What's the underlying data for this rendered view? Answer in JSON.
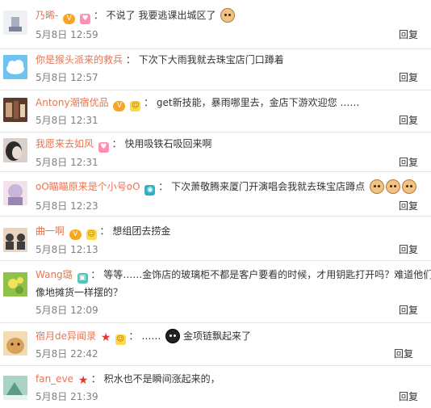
{
  "comments": [
    {
      "user": "乃晞-",
      "badges": [
        "vip",
        "heart"
      ],
      "text": "不说了 我要逃课出城区了",
      "emojis": [
        "emoji-doge"
      ],
      "date": "5月8日 12:59",
      "reply": "回复",
      "avatar_colors": [
        "#eef0f4",
        "#a7b0c2"
      ]
    },
    {
      "user": "你是猴头派来的救兵",
      "badges": [],
      "text": "下次下大雨我就去珠宝店门口蹲着",
      "emojis": [],
      "date": "5月8日 12:57",
      "reply": "回复",
      "avatar_colors": [
        "#6ec3f0",
        "#ffffff"
      ]
    },
    {
      "user": "Antony潮宿优品",
      "badges": [
        "vip",
        "face"
      ],
      "text": "get新技能，暴雨哪里去，金店下游欢迎您 ……",
      "emojis": [],
      "date": "5月8日 12:31",
      "reply": "回复",
      "avatar_colors": [
        "#5a3b2e",
        "#c9a27f"
      ]
    },
    {
      "user": "我愿来去如风",
      "badges": [
        "heart"
      ],
      "text": "快用吸铁石吸回来啊",
      "emojis": [],
      "date": "5月8日 12:31",
      "reply": "回复",
      "avatar_colors": [
        "#2a2a2a",
        "#d9d0cc"
      ]
    },
    {
      "user": "oO瞄瞄原来是个小号oO",
      "badges": [
        "cam"
      ],
      "text": "下次萧敬腾来厦门开演唱会我就去珠宝店蹲点",
      "emojis": [
        "emoji-doge",
        "emoji-doge",
        "emoji-doge"
      ],
      "date": "5月8日 12:23",
      "reply": "回复",
      "avatar_colors": [
        "#c7b6d8",
        "#f2e3ea"
      ]
    },
    {
      "user": "曲一啊",
      "badges": [
        "vip",
        "face"
      ],
      "text": "想组团去捞金",
      "emojis": [],
      "date": "5月8日 12:13",
      "reply": "回复",
      "avatar_colors": [
        "#3d3d3d",
        "#e8d4c0"
      ]
    },
    {
      "user": "Wang璐",
      "badges": [
        "tv"
      ],
      "text": "等等……金饰店的玻璃柜不都是客户要看的时候，才用钥匙打开吗？难道他们那",
      "text2": "像地摊货一样摆的？",
      "emojis": [],
      "date": "5月8日 12:09",
      "reply": "回复",
      "avatar_colors": [
        "#8fc24a",
        "#f4e15a"
      ]
    },
    {
      "user": "宿月de异闻录",
      "badges": [
        "star",
        "face"
      ],
      "text": "……",
      "emojis": [
        "emoji-black"
      ],
      "text_after": "金项链飘起来了",
      "date": "5月8日 22:42",
      "reply": "回复",
      "avatar_colors": [
        "#d9a25a",
        "#f3dcb4"
      ]
    },
    {
      "user": "fan_eve",
      "badges": [
        "star"
      ],
      "text": "积水也不是瞬间涨起来的，",
      "emojis": [],
      "date": "5月8日 21:39",
      "reply": "回复",
      "avatar_colors": [
        "#a8d3c5",
        "#5b9a86"
      ]
    }
  ]
}
